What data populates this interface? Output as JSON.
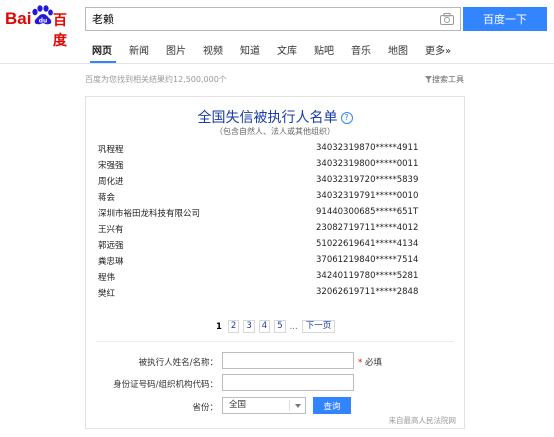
{
  "logo": {
    "text1": "Bai",
    "text2": "百度"
  },
  "search": {
    "value": "老赖",
    "button_label": "百度一下"
  },
  "nav": {
    "tabs": [
      "网页",
      "新闻",
      "图片",
      "视频",
      "知道",
      "文库",
      "贴吧",
      "音乐",
      "地图",
      "更多»"
    ]
  },
  "result_count": "百度为您找到相关结果约12,500,000个",
  "tools_label": "搜索工具",
  "card": {
    "title": "全国失信被执行人名单",
    "subtitle": "（包含自然人、法人或其他组织）",
    "rows": [
      {
        "name": "巩程程",
        "id": "34032319870*****4911"
      },
      {
        "name": "宋强强",
        "id": "34032319800*****0011"
      },
      {
        "name": "周化进",
        "id": "34032319720*****5839"
      },
      {
        "name": "蒋会",
        "id": "34032319791*****0010"
      },
      {
        "name": "深圳市裕田龙科技有限公司",
        "id": "91440300685*****651T"
      },
      {
        "name": "王兴有",
        "id": "23082719711*****4012"
      },
      {
        "name": "郭远强",
        "id": "51022619641*****4134"
      },
      {
        "name": "粪忠琳",
        "id": "37061219840*****7514"
      },
      {
        "name": "程伟",
        "id": "34240119780*****5281"
      },
      {
        "name": "樊红",
        "id": "32062619711*****2848"
      }
    ],
    "pager": {
      "current": "1",
      "pages": [
        "2",
        "3",
        "4",
        "5"
      ],
      "ellipsis": "...",
      "next": "下一页"
    },
    "form": {
      "name_label": "被执行人姓名/名称：",
      "required": "必填",
      "id_label": "身份证号码/组织机构代码：",
      "province_label": "省份：",
      "province_value": "全国",
      "query_button": "查询"
    },
    "source": "来自最高人民法院网"
  }
}
